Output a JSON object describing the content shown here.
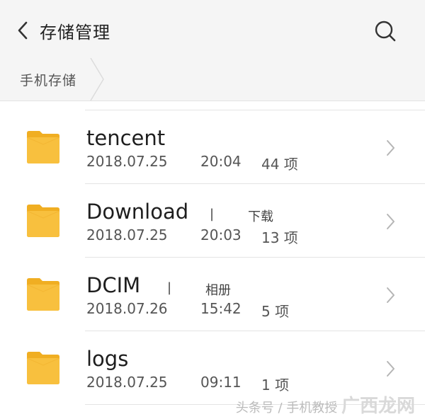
{
  "header": {
    "title": "存储管理"
  },
  "breadcrumb": {
    "items": [
      "手机存储"
    ]
  },
  "files": [
    {
      "name": "tencent",
      "separator": "",
      "alias": "",
      "date": "2018.07.25",
      "time": "20:04",
      "count": "44 项"
    },
    {
      "name": "Download",
      "separator": "|",
      "alias": "下载",
      "date": "2018.07.25",
      "time": "20:03",
      "count": "13 项"
    },
    {
      "name": "DCIM",
      "separator": "|",
      "alias": "相册",
      "date": "2018.07.26",
      "time": "15:42",
      "count": "5 项"
    },
    {
      "name": "logs",
      "separator": "",
      "alias": "",
      "date": "2018.07.25",
      "time": "09:11",
      "count": "1 项"
    }
  ],
  "watermark": {
    "source": "头条号 / 手机教授",
    "brand": "广西龙网"
  },
  "colors": {
    "folder": "#f8c03e",
    "folder_dark": "#f0ae22",
    "header_bg": "#f5f5f5"
  }
}
